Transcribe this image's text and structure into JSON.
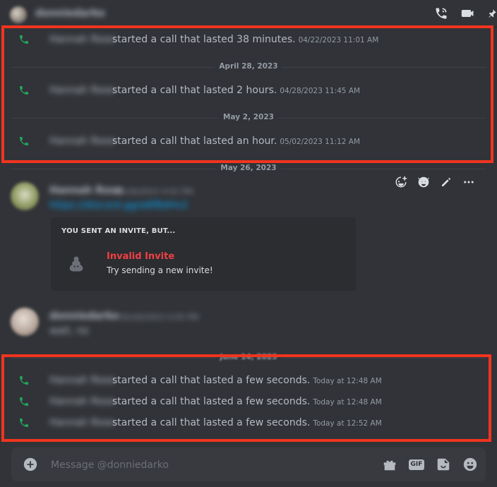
{
  "header": {
    "username": "donniedarko",
    "icons": [
      "phone-call-icon",
      "video-camera-icon",
      "pin-icon"
    ]
  },
  "calls_group_1": [
    {
      "caller": "Hannah Rose",
      "text": "started a call that lasted 38 minutes.",
      "time": "04/22/2023 11:01 AM"
    },
    {
      "caller": "Hannah Rose",
      "text": "started a call that lasted 2 hours.",
      "time": "04/28/2023 11:45 AM"
    },
    {
      "caller": "Hannah Rose",
      "text": "started a call that lasted an hour.",
      "time": "05/02/2023 11:12 AM"
    }
  ],
  "dividers": {
    "d1": "April 28, 2023",
    "d2": "May 2, 2023",
    "d3": "May 26, 2023",
    "d4": "June 14, 2023"
  },
  "message_1": {
    "author": "Hannah Rose",
    "timestamp": "05/26/2023 4:02 PM",
    "link": "https://discord.gg/a8fBdHv2",
    "invite_heading": "YOU SENT AN INVITE, BUT...",
    "invite_title": "Invalid Invite",
    "invite_subtitle": "Try sending a new invite!"
  },
  "message_2": {
    "author": "donniedarko",
    "timestamp": "05/26/2023 4:05 PM",
    "text": "wait, no"
  },
  "calls_group_2": [
    {
      "caller": "Hannah Rose",
      "text": "started a call that lasted a few seconds.",
      "time": "Today at 12:48 AM"
    },
    {
      "caller": "Hannah Rose",
      "text": "started a call that lasted a few seconds.",
      "time": "Today at 12:48 AM"
    },
    {
      "caller": "Hannah Rose",
      "text": "started a call that lasted a few seconds.",
      "time": "Today at 12:52 AM"
    }
  ],
  "composer": {
    "placeholder": "Message @donniedarko",
    "gif_label": "GIF"
  },
  "colors": {
    "background": "#313338",
    "call_green": "#23a55a",
    "highlight_red": "#f2341f",
    "invalid_red": "#f23f43",
    "link_blue": "#00a8fc"
  }
}
